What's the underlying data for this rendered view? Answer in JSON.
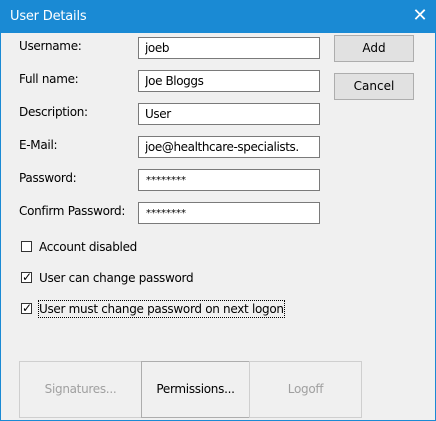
{
  "window": {
    "title": "User Details",
    "close_glyph": "✕",
    "title_bar_color": "#1a8ad4"
  },
  "form": {
    "username": {
      "label": "Username:",
      "value": "joeb"
    },
    "full_name": {
      "label": "Full name:",
      "value": "Joe Bloggs"
    },
    "description": {
      "label": "Description:",
      "value": "User"
    },
    "email": {
      "label": "E-Mail:",
      "value": "joe@healthcare-specialists."
    },
    "password": {
      "label": "Password:",
      "value": "********"
    },
    "confirm_password": {
      "label": "Confirm Password:",
      "value": "********"
    }
  },
  "buttons": {
    "add": "Add",
    "cancel": "Cancel"
  },
  "checkboxes": {
    "account_disabled": {
      "label": "Account disabled",
      "checked": false
    },
    "user_can_change_password": {
      "label": "User can change password",
      "checked": true
    },
    "user_must_change_password": {
      "label": "User must change password on next logon",
      "checked": true
    }
  },
  "bottom_buttons": {
    "signatures": {
      "label": "Signatures...",
      "enabled": false
    },
    "permissions": {
      "label": "Permissions...",
      "enabled": true
    },
    "logoff": {
      "label": "Logoff",
      "enabled": false
    }
  }
}
